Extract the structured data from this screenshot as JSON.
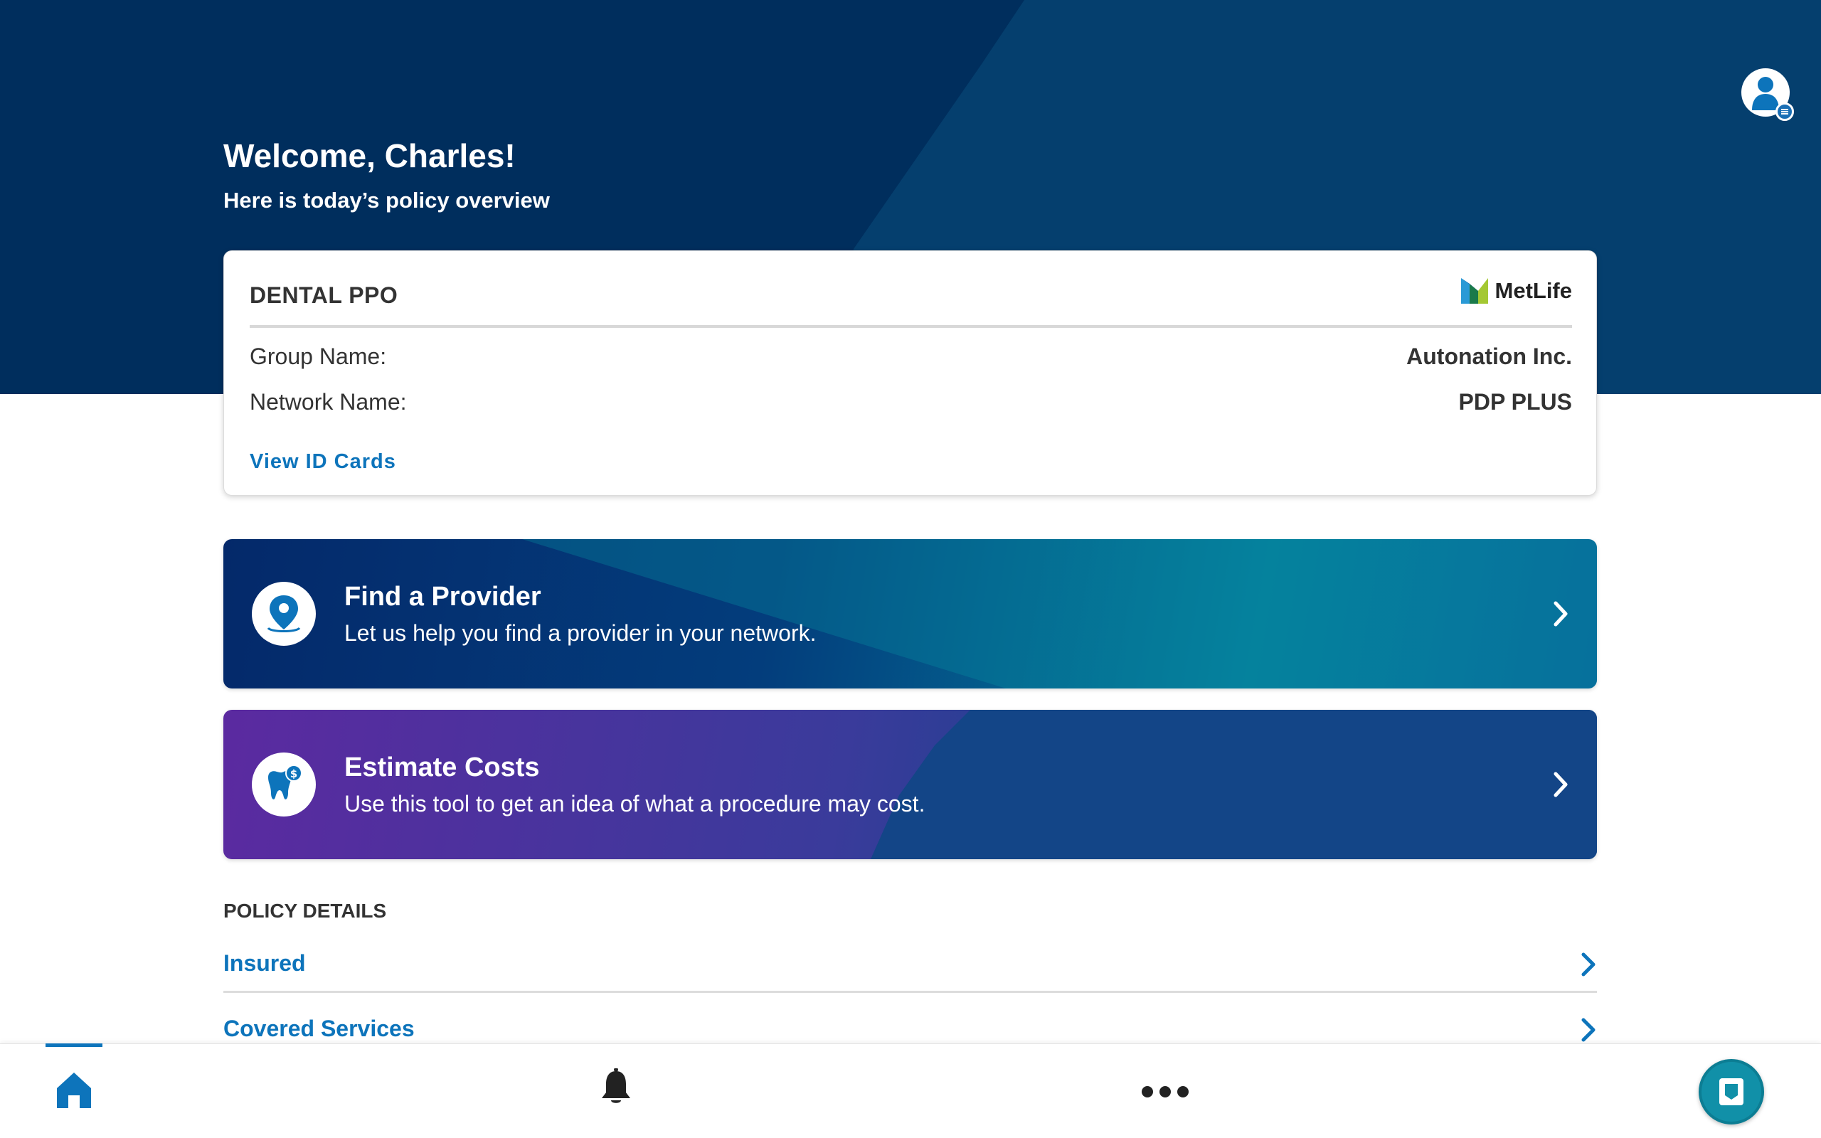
{
  "header": {
    "welcome": "Welcome, Charles!",
    "subtitle": "Here is today’s policy overview"
  },
  "policy_card": {
    "title": "DENTAL PPO",
    "brand": "MetLife",
    "rows": [
      {
        "label": "Group Name:",
        "value": "Autonation Inc."
      },
      {
        "label": "Network Name:",
        "value": "PDP PLUS"
      }
    ],
    "link": "View ID Cards"
  },
  "actions": [
    {
      "title": "Find a Provider",
      "description": "Let us help you find a provider in your network.",
      "icon": "map-pin-icon"
    },
    {
      "title": "Estimate Costs",
      "description": "Use this tool to get an idea of what a procedure may cost.",
      "icon": "tooth-dollar-icon"
    }
  ],
  "policy_details": {
    "heading": "POLICY DETAILS",
    "items": [
      {
        "label": "Insured"
      },
      {
        "label": "Covered Services"
      }
    ]
  },
  "bottom_nav": {
    "items": [
      "home-icon",
      "bell-icon",
      "more-icon"
    ],
    "active": "home-icon",
    "fab": "id-card-icon"
  },
  "colors": {
    "header_bg": "#053f6e",
    "link": "#0d74bb",
    "fab": "#1190a8"
  }
}
